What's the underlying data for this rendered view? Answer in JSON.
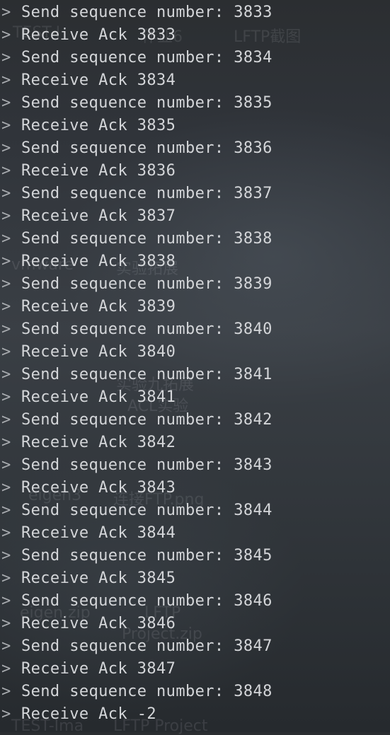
{
  "prompt_symbol": ">",
  "lines": [
    "Send sequence number: 3833",
    "Receive Ack 3833",
    "Send sequence number: 3834",
    "Receive Ack 3834",
    "Send sequence number: 3835",
    "Receive Ack 3835",
    "Send sequence number: 3836",
    "Receive Ack 3836",
    "Send sequence number: 3837",
    "Receive Ack 3837",
    "Send sequence number: 3838",
    "Receive Ack 3838",
    "Send sequence number: 3839",
    "Receive Ack 3839",
    "Send sequence number: 3840",
    "Receive Ack 3840",
    "Send sequence number: 3841",
    "Receive Ack 3841",
    "Send sequence number: 3842",
    "Receive Ack 3842",
    "Send sequence number: 3843",
    "Receive Ack 3843",
    "Send sequence number: 3844",
    "Receive Ack 3844",
    "Send sequence number: 3845",
    "Receive Ack 3845",
    "Send sequence number: 3846",
    "Receive Ack 3846",
    "Send sequence number: 3847",
    "Receive Ack 3847",
    "Send sequence number: 3848",
    "Receive Ack -2"
  ],
  "background_labels": [
    "TEST-I",
    "作业6",
    "LFTP截图",
    "vmware",
    "实验拓展",
    "实验九拓展",
    "ACL实验",
    "eigen3",
    "连接FTP.png",
    "eigen.zip",
    "LFTP",
    "Project.zip",
    "TEST-Ima",
    "LFTP Project"
  ]
}
